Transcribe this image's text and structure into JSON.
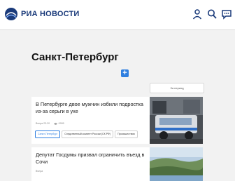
{
  "header": {
    "logo_text": "РИА НОВОСТИ",
    "icons": [
      "user-icon",
      "search-icon",
      "chat-icon"
    ]
  },
  "page": {
    "title": "Санкт-Петербург",
    "add_label": "+",
    "period_label": "За период"
  },
  "articles": [
    {
      "title": "В Петербурге двое мужчин избили подростка из-за серьги в ухе",
      "date": "Вчера 23:20",
      "views": "0995",
      "tags": [
        "Санкт-Петербург",
        "Следственный комитет России (СК РФ)",
        "Происшествия"
      ]
    },
    {
      "title": "Депутат Госдумы призвал ограничить въезд в Сочи",
      "date": "Вчера",
      "views": "",
      "tags": []
    }
  ],
  "colors": {
    "accent": "#2f7fe0",
    "brand": "#1a3a7a",
    "background": "#f2f2f2"
  }
}
